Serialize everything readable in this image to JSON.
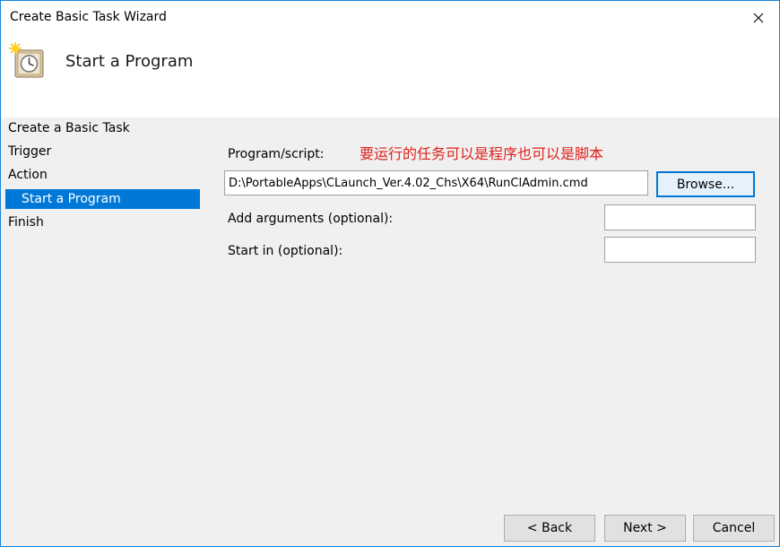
{
  "window": {
    "title": "Create Basic Task Wizard"
  },
  "header": {
    "title": "Start a Program",
    "icon": "task-clock-icon"
  },
  "sidebar": {
    "steps": [
      {
        "label": "Create a Basic Task"
      },
      {
        "label": "Trigger"
      },
      {
        "label": "Action"
      },
      {
        "label": "Start a Program",
        "active": true
      },
      {
        "label": "Finish"
      }
    ]
  },
  "form": {
    "program_label": "Program/script:",
    "program_value": "D:\\PortableApps\\CLaunch_Ver.4.02_Chs\\X64\\RunClAdmin.cmd",
    "browse_label": "Browse...",
    "arguments_label": "Add arguments (optional):",
    "arguments_value": "",
    "start_in_label": "Start in (optional):",
    "start_in_value": "",
    "annotation": "要运行的任务可以是程序也可以是脚本"
  },
  "footer": {
    "back_label": "< Back",
    "next_label": "Next >",
    "cancel_label": "Cancel"
  },
  "colors": {
    "accent": "#0078d7",
    "annotation": "#e0201a"
  }
}
